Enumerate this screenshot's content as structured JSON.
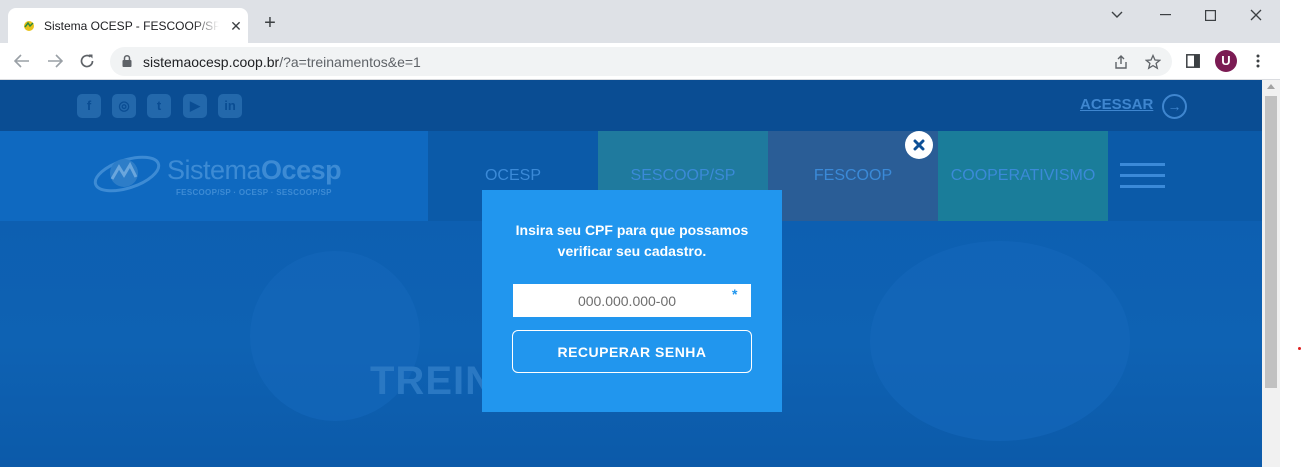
{
  "browser": {
    "tab_title": "Sistema OCESP - FESCOOP/SP, O",
    "url_host": "sistemaocesp.coop.br",
    "url_path": "/?a=treinamentos&e=1",
    "profile_initial": "U"
  },
  "site": {
    "acessar_label": "ACESSAR",
    "logo_text_light": "Sistema",
    "logo_text_bold": "Ocesp",
    "logo_subtitle": "FESCOOP/SP · OCESP · SESCOOP/SP",
    "nav": [
      {
        "label": "OCESP",
        "color": ""
      },
      {
        "label": "SESCOOP/SP",
        "color": "#1f7a9e"
      },
      {
        "label": "FESCOOP",
        "color": "#2a5d96"
      },
      {
        "label": "COOPERATIVISMO",
        "color": "#1a7d9a"
      }
    ],
    "hero_title": "TREINAMENTOS"
  },
  "modal": {
    "text_before": "Insira seu ",
    "text_bold": "CPF",
    "text_after": " para que possamos verificar seu cadastro.",
    "cpf_placeholder": "000.000.000-00",
    "required_mark": "*",
    "button_label": "RECUPERAR SENHA"
  },
  "colors": {
    "modal_bg": "#2196ee",
    "page_bg": "#0f63b8",
    "overlay": "#0a4d93"
  }
}
